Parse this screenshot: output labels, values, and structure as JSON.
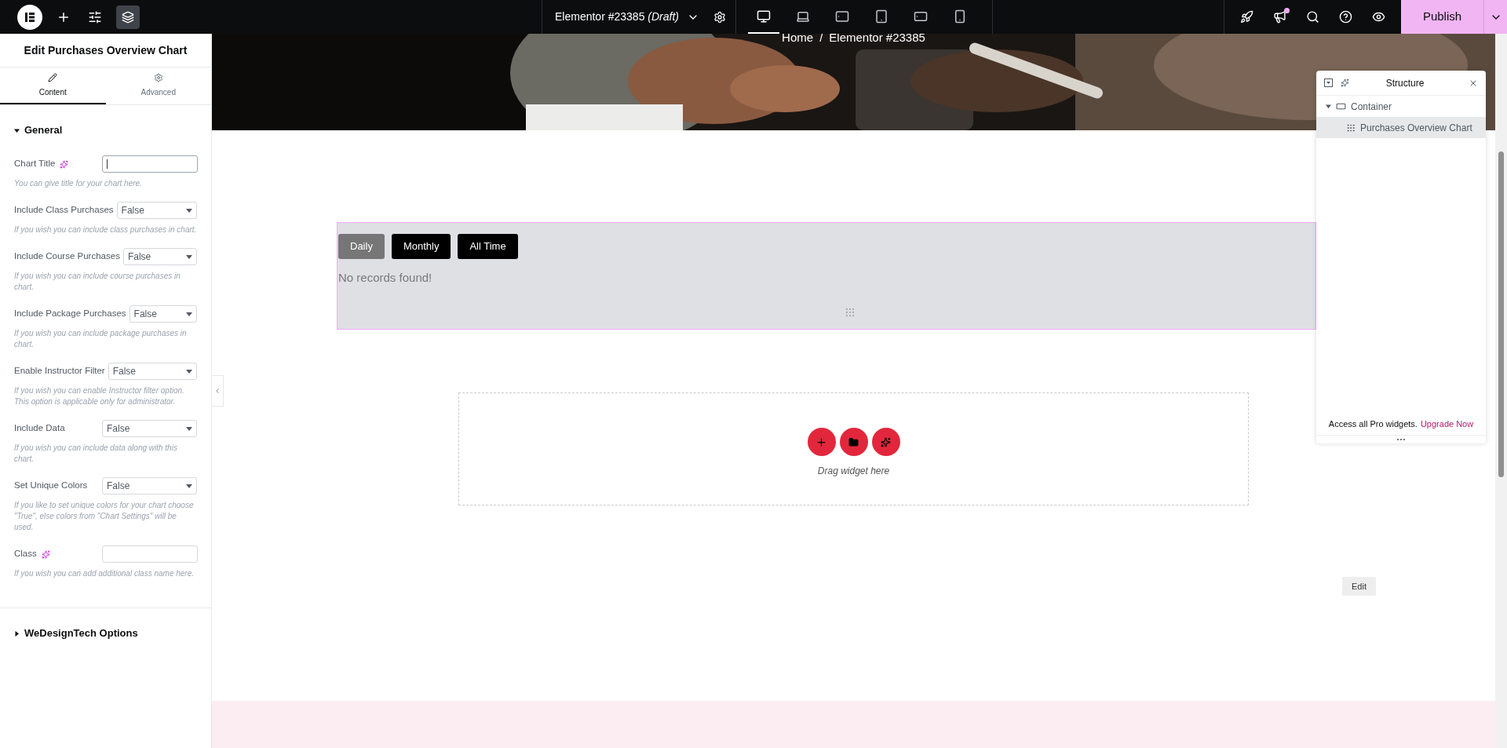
{
  "topbar": {
    "doc_title": "Elementor #23385",
    "doc_status": "(Draft)",
    "devices": [
      {
        "kind": "desktop",
        "selected": true
      },
      {
        "kind": "laptop",
        "selected": false
      },
      {
        "kind": "tablet-landscape",
        "selected": false
      },
      {
        "kind": "tablet",
        "selected": false
      },
      {
        "kind": "mobile-landscape",
        "selected": false
      },
      {
        "kind": "mobile",
        "selected": false
      }
    ],
    "layers_selected": true,
    "notification_dot": true,
    "publish": "Publish"
  },
  "panel": {
    "title": "Edit Purchases Overview Chart",
    "tabs": [
      {
        "label": "Content",
        "kind": "pencil",
        "selected": true
      },
      {
        "label": "Advanced",
        "kind": "gear",
        "selected": false
      }
    ],
    "sections": [
      {
        "title": "General",
        "expanded": true,
        "fields": [
          {
            "kind": "text",
            "label": "Chart Title",
            "ai": true,
            "focused": true,
            "hint": "You can give title for your chart here."
          },
          {
            "kind": "select",
            "label": "Include Class Purchases",
            "ai": false,
            "value": "False",
            "hint": "If you wish you can include class purchases in chart."
          },
          {
            "kind": "select",
            "label": "Include Course Purchases",
            "ai": false,
            "value": "False",
            "hint": "If you wish you can include course purchases in chart."
          },
          {
            "kind": "select",
            "label": "Include Package Purchases",
            "ai": false,
            "value": "False",
            "hint": "If you wish you can include package purchases in chart."
          },
          {
            "kind": "select",
            "label": "Enable Instructor Filter",
            "ai": false,
            "value": "False",
            "hint": "If you wish you can enable Instructor filter option. This option is applicable only for administrator."
          },
          {
            "kind": "select",
            "label": "Include Data",
            "ai": false,
            "value": "False",
            "hint": "If you wish you can include data along with this chart."
          },
          {
            "kind": "select",
            "label": "Set Unique Colors",
            "ai": false,
            "value": "False",
            "hint": "If you like to set unique colors for your chart choose \"True\", else colors from \"Chart Settings\" will be used."
          },
          {
            "kind": "text",
            "label": "Class",
            "ai": true,
            "focused": false,
            "hint": "If you wish you can add additional class name here."
          }
        ]
      },
      {
        "title": "WeDesignTech Options",
        "expanded": false
      }
    ]
  },
  "canvas": {
    "breadcrumb": [
      "Home",
      "/",
      "Elementor #23385"
    ],
    "chart_widget": {
      "tabs": [
        {
          "label": "Daily",
          "selected": true
        },
        {
          "label": "Monthly",
          "selected": false
        },
        {
          "label": "All Time",
          "selected": false
        }
      ],
      "message": "No records found!"
    },
    "drop_zone": {
      "hint": "Drag widget here"
    },
    "edit_button": "Edit"
  },
  "structure": {
    "title": "Structure",
    "tree": [
      {
        "label": "Container",
        "kind": "container",
        "expanded": true,
        "selected": false,
        "children": [
          {
            "label": "Purchases Overview Chart",
            "kind": "widget",
            "selected": true
          }
        ]
      }
    ],
    "promo": "Access all Pro widgets.",
    "promo_link": "Upgrade Now"
  }
}
